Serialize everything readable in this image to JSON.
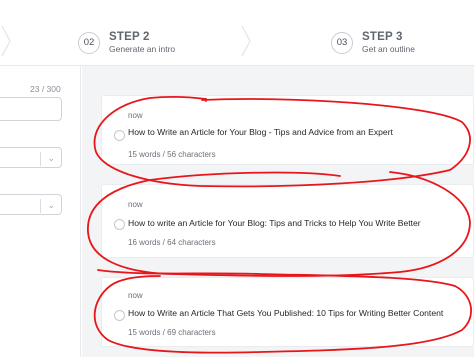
{
  "steps": [
    {
      "number": "02",
      "title": "STEP 2",
      "subtitle": "Generate an intro"
    },
    {
      "number": "03",
      "title": "STEP 3",
      "subtitle": "Get an outline"
    }
  ],
  "left_panel": {
    "char_count": "23 / 300"
  },
  "results": [
    {
      "time": "now",
      "title": "How to Write an Article for Your Blog - Tips and Advice from an Expert",
      "meta": "15 words / 56 characters"
    },
    {
      "time": "now",
      "title": "How to write an Article for Your Blog: Tips and Tricks to Help You Write Better",
      "meta": "16 words / 64 characters"
    },
    {
      "time": "now",
      "title": "How to Write an Article That Gets You Published: 10 Tips for Writing Better Content",
      "meta": "15 words / 69 characters"
    }
  ],
  "colors": {
    "annotation": "#e8161b",
    "panel_bg": "#f3f4f6"
  }
}
